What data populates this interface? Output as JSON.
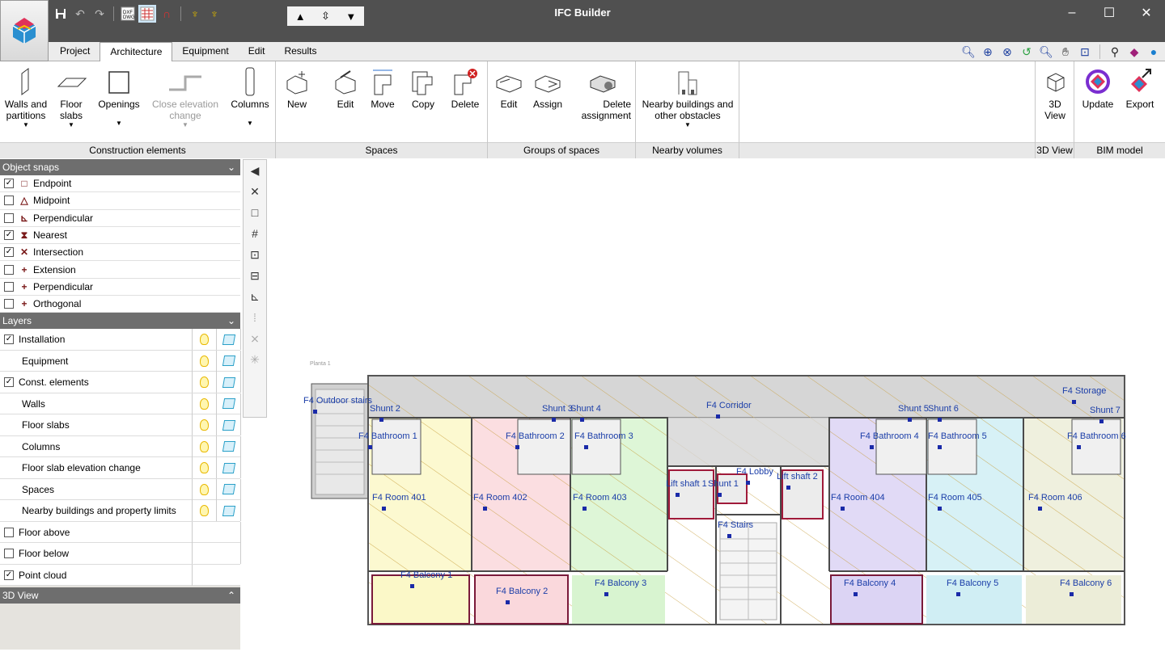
{
  "app": {
    "title": "IFC Builder"
  },
  "window_controls": {
    "minimize": "–",
    "maximize": "☐",
    "close": "✕"
  },
  "menu_tabs": [
    {
      "label": "Project"
    },
    {
      "label": "Architecture"
    },
    {
      "label": "Equipment"
    },
    {
      "label": "Edit"
    },
    {
      "label": "Results"
    }
  ],
  "ribbon": {
    "construction": {
      "group_label": "Construction elements",
      "walls": "Walls and partitions",
      "floor_slabs": "Floor slabs",
      "openings": "Openings",
      "close_elevation": "Close elevation change",
      "columns": "Columns"
    },
    "spaces": {
      "group_label": "Spaces",
      "new": "New",
      "edit": "Edit",
      "move": "Move",
      "copy": "Copy",
      "delete": "Delete"
    },
    "groups": {
      "group_label": "Groups of spaces",
      "edit": "Edit",
      "assign": "Assign",
      "delete_assignment": "Delete assignment"
    },
    "nearby": {
      "group_label": "Nearby volumes",
      "nearby_buildings": "Nearby buildings and other obstacles"
    },
    "view3d": {
      "group_label": "3D View",
      "button": "3D View"
    },
    "bim": {
      "group_label": "BIM model",
      "update": "Update",
      "export": "Export"
    }
  },
  "object_snaps": {
    "header": "Object snaps",
    "items": [
      {
        "label": "Endpoint",
        "checked": "✓",
        "icon": "□"
      },
      {
        "label": "Midpoint",
        "checked": "",
        "icon": "△"
      },
      {
        "label": "Perpendicular",
        "checked": "",
        "icon": "⊾"
      },
      {
        "label": "Nearest",
        "checked": "✓",
        "icon": "⧗"
      },
      {
        "label": "Intersection",
        "checked": "✓",
        "icon": "✕"
      },
      {
        "label": "Extension",
        "checked": "",
        "icon": "+"
      },
      {
        "label": "Perpendicular",
        "checked": "",
        "icon": "+"
      },
      {
        "label": "Orthogonal",
        "checked": "",
        "icon": "+"
      }
    ]
  },
  "layers": {
    "header": "Layers",
    "items": [
      {
        "label": "Installation",
        "checked": "✓",
        "has_checkbox": true
      },
      {
        "label": "Equipment",
        "checked": "",
        "has_checkbox": false
      },
      {
        "label": "Const. elements",
        "checked": "✓",
        "has_checkbox": true
      },
      {
        "label": "Walls",
        "checked": "",
        "has_checkbox": false
      },
      {
        "label": "Floor slabs",
        "checked": "",
        "has_checkbox": false
      },
      {
        "label": "Columns",
        "checked": "",
        "has_checkbox": false
      },
      {
        "label": "Floor slab elevation change",
        "checked": "",
        "has_checkbox": false
      },
      {
        "label": "Spaces",
        "checked": "",
        "has_checkbox": false
      },
      {
        "label": "Nearby buildings and property limits",
        "checked": "",
        "has_checkbox": false
      },
      {
        "label": "Floor above",
        "checked": "",
        "has_checkbox": true
      },
      {
        "label": "Floor below",
        "checked": "",
        "has_checkbox": true
      },
      {
        "label": "Point cloud",
        "checked": "✓",
        "has_checkbox": true
      }
    ]
  },
  "view3d_panel": {
    "header": "3D View"
  },
  "drawing": {
    "plan_label": "Planta 1",
    "rooms": [
      {
        "label": "F4 Outdoor stairs"
      },
      {
        "label": "Shunt 2"
      },
      {
        "label": "Shunt 3"
      },
      {
        "label": "Shunt 4"
      },
      {
        "label": "F4 Corridor"
      },
      {
        "label": "Shunt 5"
      },
      {
        "label": "Shunt 6"
      },
      {
        "label": "F4 Storage"
      },
      {
        "label": "Shunt 7"
      },
      {
        "label": "F4 Bathroom 1"
      },
      {
        "label": "F4 Bathroom 2"
      },
      {
        "label": "F4 Bathroom 3"
      },
      {
        "label": "F4 Bathroom 4"
      },
      {
        "label": "F4 Bathroom 5"
      },
      {
        "label": "F4 Bathroom 6"
      },
      {
        "label": "Shunt 1"
      },
      {
        "label": "Lift shaft 1"
      },
      {
        "label": "F4 Lobby"
      },
      {
        "label": "Lift shaft 2"
      },
      {
        "label": "F4 Room 401"
      },
      {
        "label": "F4 Room 402"
      },
      {
        "label": "F4 Room 403"
      },
      {
        "label": "F4 Room 404"
      },
      {
        "label": "F4 Room 405"
      },
      {
        "label": "F4 Room 406"
      },
      {
        "label": "F4 Stairs"
      },
      {
        "label": "F4 Balcony 1"
      },
      {
        "label": "F4 Balcony 2"
      },
      {
        "label": "F4 Balcony 3"
      },
      {
        "label": "F4 Balcony 4"
      },
      {
        "label": "F4 Balcony 5"
      },
      {
        "label": "F4 Balcony 6"
      }
    ]
  }
}
